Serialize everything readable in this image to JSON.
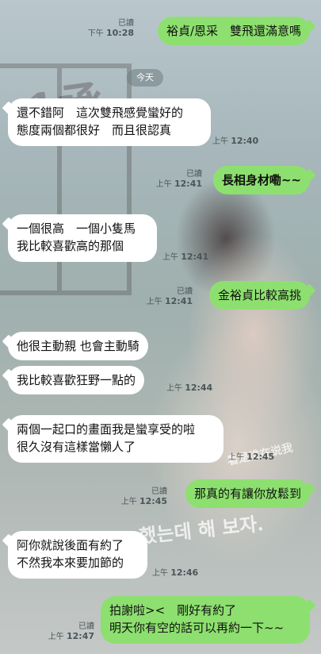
{
  "date_separator": "今天",
  "background": {
    "deco_1": "-1承",
    "deco_2": "看是谁在说我",
    "deco_3": "했는데 해 보자."
  },
  "messages": [
    {
      "dir": "out",
      "lines": [
        "裕貞/恩采　雙飛還滿意嗎"
      ],
      "read": "已讀",
      "time_prefix": "下午",
      "time": "10:28"
    },
    {
      "dir": "in",
      "lines": [
        "還不錯阿　這次雙飛感覺蠻好的",
        "態度兩個都很好　而且很認真"
      ],
      "time_prefix": "上午",
      "time": "12:40"
    },
    {
      "dir": "out",
      "lines": [
        "長相身材嘞~~"
      ],
      "read": "已讀",
      "time_prefix": "上午",
      "time": "12:41"
    },
    {
      "dir": "in",
      "lines": [
        "一個很高　一個小隻馬",
        "我比較喜歡高的那個"
      ],
      "time_prefix": "上午",
      "time": "12:41"
    },
    {
      "dir": "out",
      "lines": [
        "金裕貞比較高挑"
      ],
      "read": "已讀",
      "time_prefix": "上午",
      "time": "12:41"
    },
    {
      "dir": "in",
      "lines": [
        "他很主動親 也會主動騎"
      ],
      "time_prefix": "",
      "time": ""
    },
    {
      "dir": "in",
      "lines": [
        "我比較喜歡狂野一點的"
      ],
      "time_prefix": "上午",
      "time": "12:44"
    },
    {
      "dir": "in",
      "lines": [
        "兩個一起口的畫面我是蠻享受的啦",
        "很久沒有這樣當懶人了"
      ],
      "time_prefix": "上午",
      "time": "12:45"
    },
    {
      "dir": "out",
      "lines": [
        "那真的有讓你放鬆到"
      ],
      "read": "已讀",
      "time_prefix": "上午",
      "time": "12:45"
    },
    {
      "dir": "in",
      "lines": [
        "阿你就說後面有約了",
        "不然我本來要加節的"
      ],
      "time_prefix": "上午",
      "time": "12:46"
    },
    {
      "dir": "out",
      "lines": [
        "拍謝啦><　剛好有約了",
        "明天你有空的話可以再約一下~~"
      ],
      "read": "已讀",
      "time_prefix": "上午",
      "time": "12:47"
    }
  ],
  "colors": {
    "incoming_bubble": "#ffffff",
    "outgoing_bubble": "#8de06f",
    "date_pill": "#6e7d82"
  }
}
